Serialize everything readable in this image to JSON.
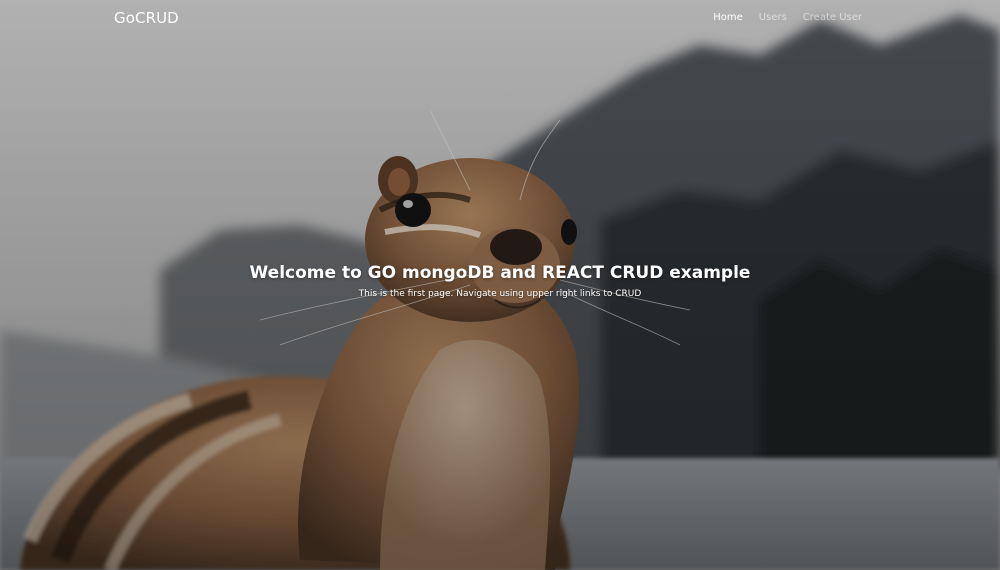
{
  "navbar": {
    "brand": "GoCRUD",
    "links": [
      {
        "label": "Home",
        "active": true
      },
      {
        "label": "Users",
        "active": false
      },
      {
        "label": "Create User",
        "active": false
      }
    ]
  },
  "hero": {
    "title": "Welcome to GO mongoDB and REACT CRUD example",
    "subtitle": "This is the first page. Navigate using upper right links to CRUD",
    "background_image_subject": "chipmunk in front of blurred mountains and lake"
  },
  "colors": {
    "nav_text_active": "#ffffff",
    "nav_text_inactive": "#b8b8b8",
    "hero_text": "#ffffff"
  }
}
